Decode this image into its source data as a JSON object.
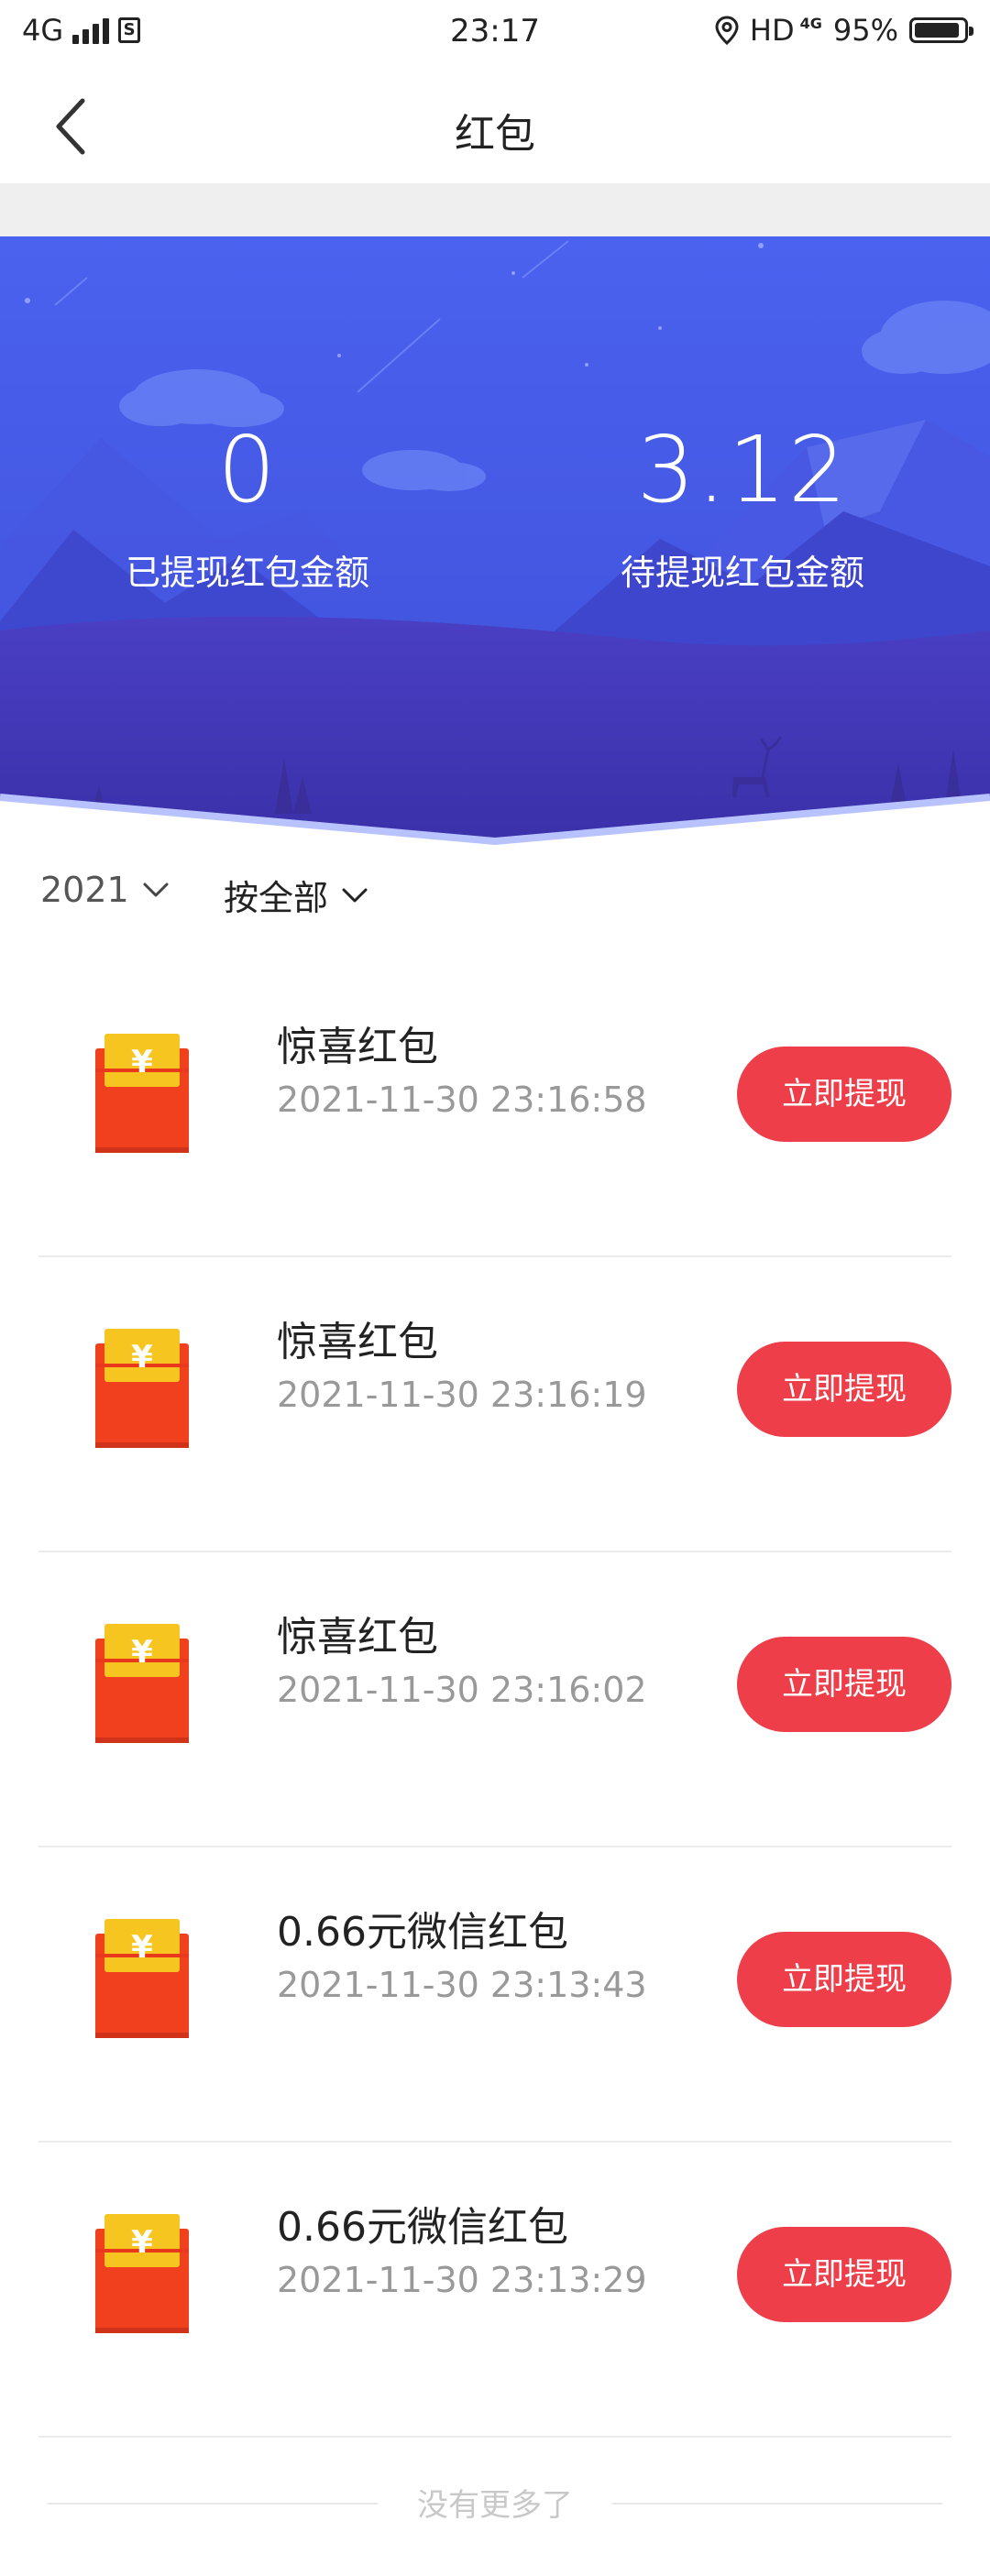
{
  "status_bar": {
    "network": "4G",
    "time": "23:17",
    "hd": "HD",
    "net_small": "4G",
    "battery": "95%"
  },
  "nav": {
    "title": "红包"
  },
  "summary": {
    "withdrawn_amount": "0",
    "withdrawn_label": "已提现红包金额",
    "pending_amount": "3.12",
    "pending_label": "待提现红包金额"
  },
  "filters": {
    "year": "2021",
    "type": "按全部"
  },
  "items": [
    {
      "title": "惊喜红包",
      "time": "2021-11-30 23:16:58",
      "button": "立即提现"
    },
    {
      "title": "惊喜红包",
      "time": "2021-11-30 23:16:19",
      "button": "立即提现"
    },
    {
      "title": "惊喜红包",
      "time": "2021-11-30 23:16:02",
      "button": "立即提现"
    },
    {
      "title": "0.66元微信红包",
      "time": "2021-11-30 23:13:43",
      "button": "立即提现"
    },
    {
      "title": "0.66元微信红包",
      "time": "2021-11-30 23:13:29",
      "button": "立即提现"
    }
  ],
  "footer": {
    "no_more": "没有更多了"
  },
  "icons": {
    "back": "back-arrow-icon",
    "location": "location-icon",
    "battery": "battery-icon",
    "dropdown": "chevron-down-icon",
    "envelope": "red-envelope-icon",
    "yuan": "¥"
  },
  "colors": {
    "banner_top": "#4a62ef",
    "banner_bottom": "#3f35b8",
    "button": "#ee3e4a",
    "envelope_red": "#f0401e",
    "envelope_gold": "#f7c51f"
  }
}
